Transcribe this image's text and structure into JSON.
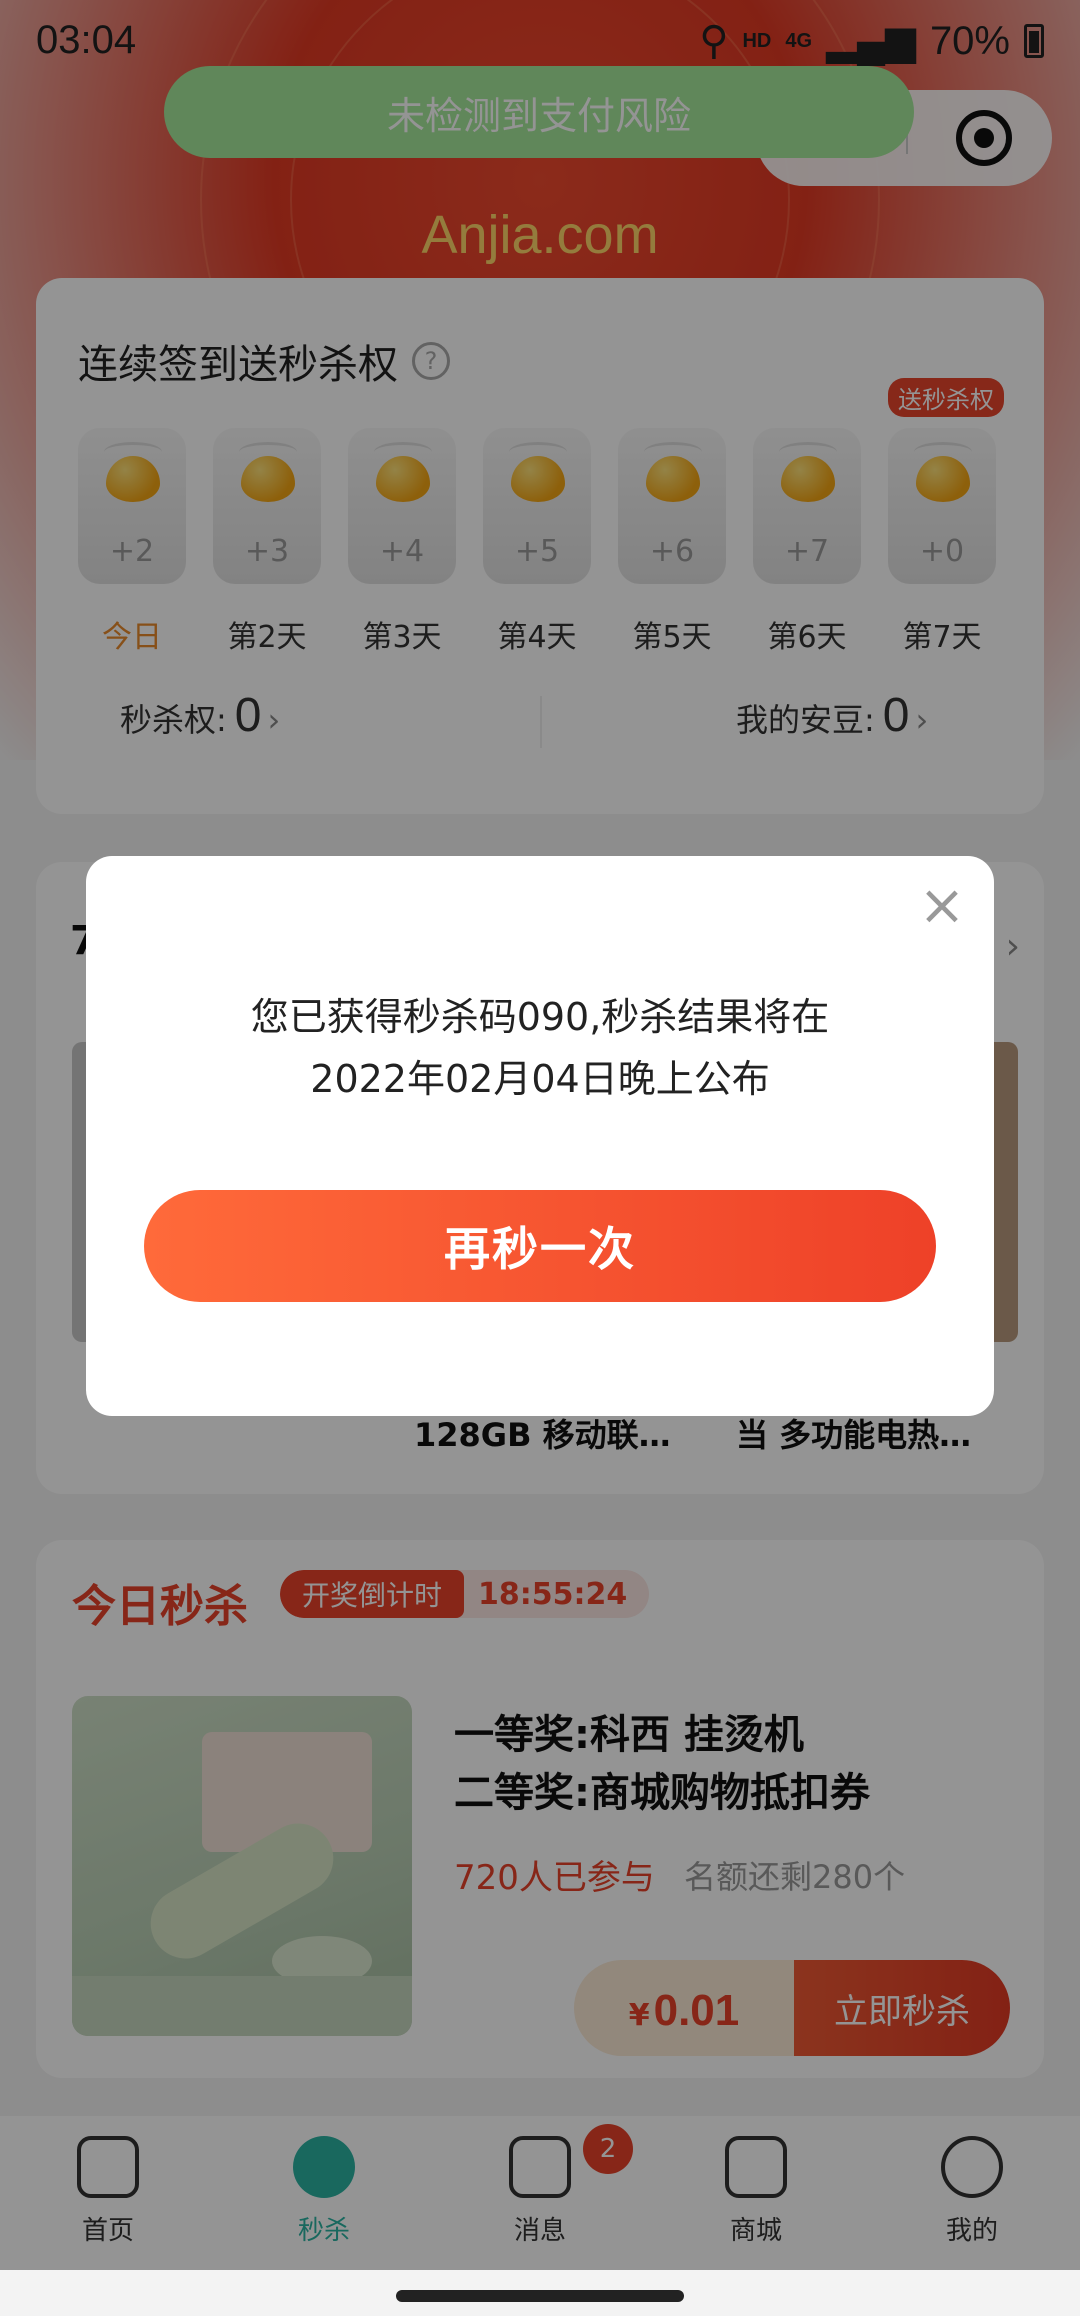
{
  "status_bar": {
    "time": "03:04",
    "hd": "HD",
    "network": "4G",
    "battery": "70%"
  },
  "toast": "未检测到支付风险",
  "logo": "Anjia.com",
  "signin": {
    "title": "连续签到送秒杀权",
    "badge": "送秒杀权",
    "days": [
      {
        "plus": "+2",
        "label": "今日"
      },
      {
        "plus": "+3",
        "label": "第2天"
      },
      {
        "plus": "+4",
        "label": "第3天"
      },
      {
        "plus": "+5",
        "label": "第4天"
      },
      {
        "plus": "+6",
        "label": "第5天"
      },
      {
        "plus": "+7",
        "label": "第6天"
      },
      {
        "plus": "+0",
        "label": "第7天"
      }
    ],
    "seckill_label": "秒杀权:",
    "seckill_value": "0",
    "beans_label": "我的安豆:",
    "beans_value": "0"
  },
  "products": {
    "heading": "7",
    "items": [
      "128GB 移动联…",
      "当 多功能电热…"
    ]
  },
  "flash": {
    "title": "今日秒杀",
    "countdown_label": "开奖倒计时",
    "countdown_time": "18:55:24",
    "prize1": "一等奖:科西 挂烫机",
    "prize2": "二等奖:商城购物抵扣券",
    "joined": "720人已参与",
    "remain": "名额还剩280个",
    "currency": "¥",
    "price": "0.01",
    "buy_label": "立即秒杀"
  },
  "nav": [
    {
      "label": "首页"
    },
    {
      "label": "秒杀"
    },
    {
      "label": "消息",
      "badge": "2"
    },
    {
      "label": "商城"
    },
    {
      "label": "我的"
    }
  ],
  "modal": {
    "line1": "您已获得秒杀码090,秒杀结果将在",
    "line2": "2022年02月04日晚上公布",
    "button": "再秒一次",
    "close": "×"
  }
}
